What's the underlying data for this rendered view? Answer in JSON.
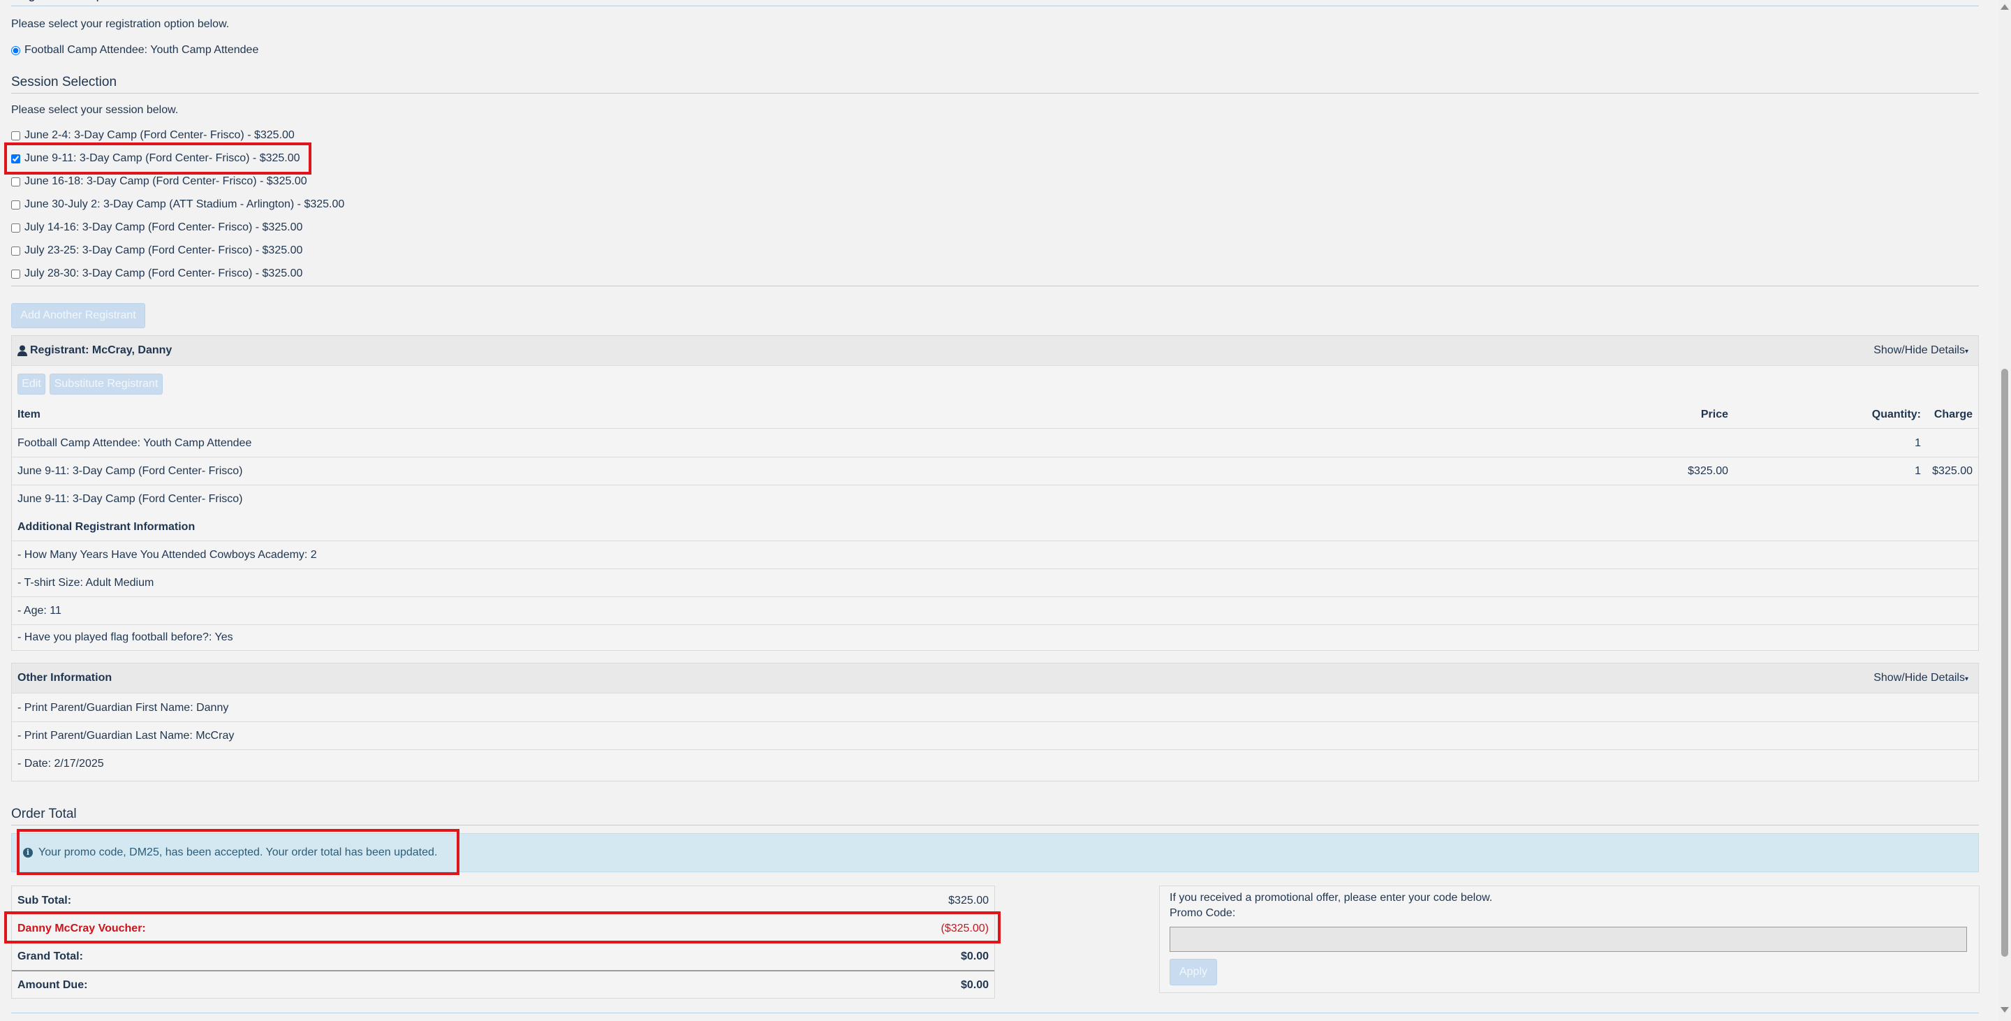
{
  "registration_option": {
    "header": "Registration Option",
    "prompt": "Please select your registration option below.",
    "selected_label": "Football Camp Attendee: Youth Camp Attendee"
  },
  "session_selection": {
    "header": "Session Selection",
    "prompt": "Please select your session below.",
    "sessions": [
      {
        "label": "June 2-4: 3-Day Camp (Ford Center- Frisco) - $325.00",
        "checked": false
      },
      {
        "label": "June 9-11: 3-Day Camp (Ford Center- Frisco) - $325.00",
        "checked": true
      },
      {
        "label": "June 16-18: 3-Day Camp (Ford Center- Frisco) - $325.00",
        "checked": false
      },
      {
        "label": "June 30-July 2: 3-Day Camp (ATT Stadium - Arlington) - $325.00",
        "checked": false
      },
      {
        "label": "July 14-16: 3-Day Camp (Ford Center- Frisco) - $325.00",
        "checked": false
      },
      {
        "label": "July 23-25: 3-Day Camp (Ford Center- Frisco) - $325.00",
        "checked": false
      },
      {
        "label": "July 28-30: 3-Day Camp (Ford Center- Frisco) - $325.00",
        "checked": false
      }
    ]
  },
  "add_registrant_label": "Add Another Registrant",
  "registrant": {
    "title": "Registrant: McCray, Danny",
    "toggle_label": "Show/Hide Details",
    "edit_label": "Edit",
    "substitute_label": "Substitute Registrant",
    "columns": {
      "item": "Item",
      "price": "Price",
      "quantity": "Quantity:",
      "charge": "Charge"
    },
    "items": [
      {
        "item": "Football Camp Attendee: Youth Camp Attendee",
        "price": "",
        "quantity": "1",
        "charge": ""
      },
      {
        "item": "June 9-11: 3-Day Camp (Ford Center- Frisco)",
        "price": "$325.00",
        "quantity": "1",
        "charge": "$325.00"
      },
      {
        "item": "June 9-11: 3-Day Camp (Ford Center- Frisco)",
        "price": "",
        "quantity": "",
        "charge": ""
      }
    ],
    "additional_header": "Additional Registrant Information",
    "additional": [
      "- How Many Years Have You Attended Cowboys Academy: 2",
      "- T-shirt Size: Adult Medium",
      "- Age: 11",
      "- Have you played flag football before?: Yes"
    ]
  },
  "other_info": {
    "title": "Other Information",
    "toggle_label": "Show/Hide Details",
    "rows": [
      "- Print Parent/Guardian First Name: Danny",
      "- Print Parent/Guardian Last Name: McCray",
      "- Date: 2/17/2025"
    ]
  },
  "order_total": {
    "header": "Order Total",
    "promo_message": "Your promo code, DM25, has been accepted. Your order total has been updated.",
    "sub_total_label": "Sub Total:",
    "sub_total_value": "$325.00",
    "voucher_label": "Danny McCray Voucher:",
    "voucher_value": "($325.00)",
    "grand_total_label": "Grand Total:",
    "grand_total_value": "$0.00",
    "amount_due_label": "Amount Due:",
    "amount_due_value": "$0.00"
  },
  "promo": {
    "intro": "If you received a promotional offer, please enter your code below.",
    "code_label": "Promo Code:",
    "code_value": "",
    "apply_label": "Apply"
  },
  "colors": {
    "highlight": "#e0141b",
    "voucher_text": "#d0121b",
    "alert_bg": "#d4e8f2"
  }
}
